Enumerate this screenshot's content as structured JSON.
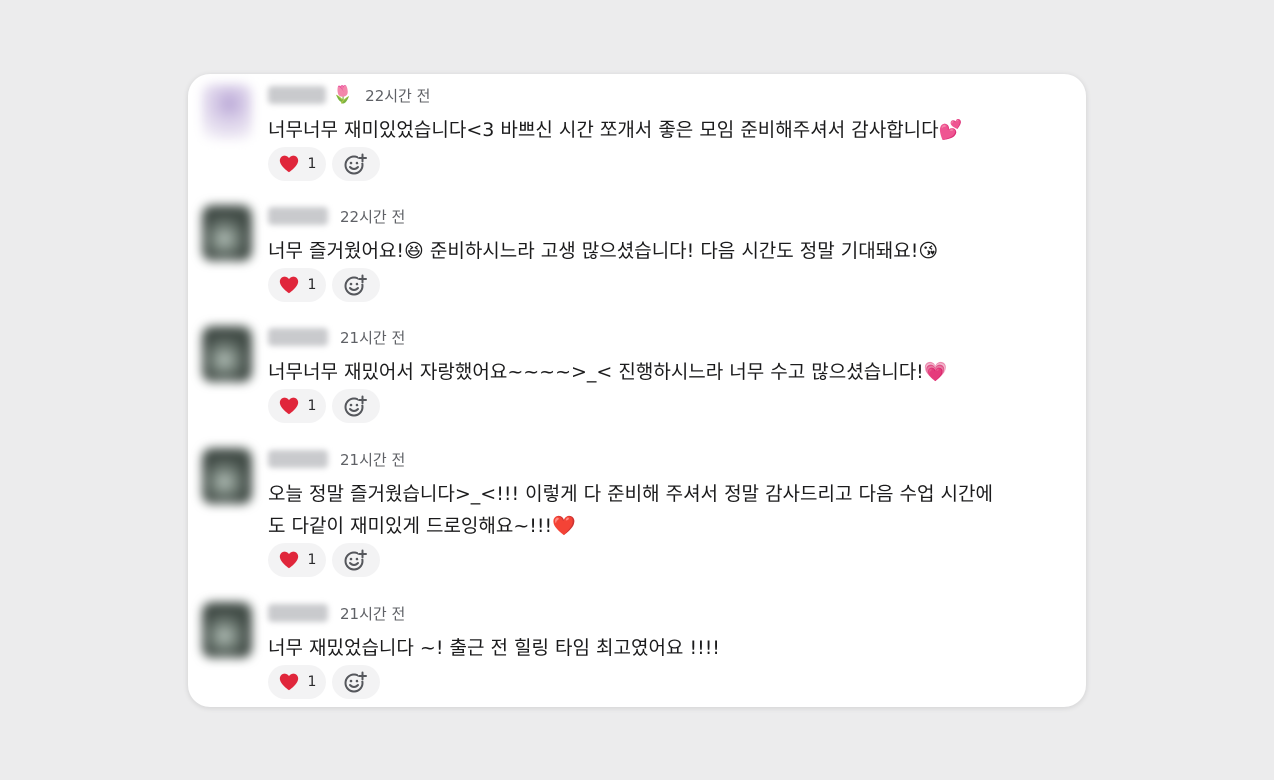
{
  "comments": [
    {
      "time": "22시간 전",
      "name_icon": "🌷",
      "lines": [
        "너무너무 재미있었습니다<3 바쁘신 시간 쪼개서 좋은 모임 준비해주셔서 감사합니다💕"
      ],
      "reaction": {
        "emoji": "heart",
        "count": "1"
      }
    },
    {
      "time": "22시간 전",
      "lines": [
        "너무 즐거웠어요!😆 준비하시느라 고생 많으셨습니다! 다음 시간도 정말 기대돼요!😘"
      ],
      "reaction": {
        "emoji": "heart",
        "count": "1"
      }
    },
    {
      "time": "21시간 전",
      "lines": [
        "너무너무 재밌어서 자랑했어요~~~~>_< 진행하시느라 너무 수고 많으셨습니다!💗"
      ],
      "reaction": {
        "emoji": "heart",
        "count": "1"
      }
    },
    {
      "time": "21시간 전",
      "lines": [
        "오늘 정말 즐거웠습니다>_<!!! 이렇게 다 준비해 주셔서 정말 감사드리고 다음 수업 시간에",
        "도 다같이 재미있게 드로잉해요~!!!❤️"
      ],
      "reaction": {
        "emoji": "heart",
        "count": "1"
      }
    },
    {
      "time": "21시간 전",
      "lines": [
        "너무 재밌었습니다 ~! 출근 전 힐링 타임 최고였어요 !!!!"
      ],
      "reaction": {
        "emoji": "heart",
        "count": "1"
      }
    }
  ],
  "colors": {
    "background": "#ececed",
    "card": "#ffffff",
    "heart": "#e0263b",
    "pill": "#f3f3f4"
  },
  "icons": {
    "reaction": "heart-icon",
    "add_reaction": "add-emoji-icon"
  }
}
